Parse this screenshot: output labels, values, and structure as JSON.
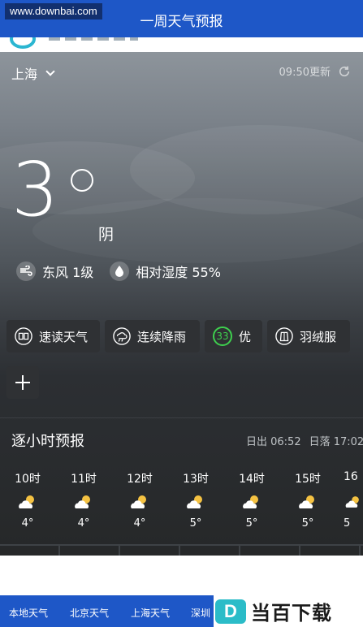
{
  "watermark": "www.downbai.com",
  "header": {
    "title": "一周天气预报"
  },
  "weather": {
    "city": "上海",
    "updated": "09:50更新",
    "temperature": "3",
    "condition": "阴",
    "wind": "东风 1级",
    "humidity": "相对湿度 55%"
  },
  "chips": [
    {
      "label": "速读天气",
      "icon": "book-icon"
    },
    {
      "label": "连续降雨",
      "icon": "rain-cloud-icon"
    },
    {
      "label": "优",
      "aqi": "33",
      "icon": "aqi-ring-icon"
    },
    {
      "label": "羽绒服",
      "icon": "coat-icon"
    }
  ],
  "hourly": {
    "title": "逐小时预报",
    "sunrise": "日出 06:52",
    "sunset": "日落 17:02",
    "items": [
      {
        "time": "10时",
        "temp": "4°"
      },
      {
        "time": "11时",
        "temp": "4°"
      },
      {
        "time": "12时",
        "temp": "4°"
      },
      {
        "time": "13时",
        "temp": "5°"
      },
      {
        "time": "14时",
        "temp": "5°"
      },
      {
        "time": "15时",
        "temp": "5°"
      },
      {
        "time": "16",
        "temp": "5"
      }
    ]
  },
  "bottom_nav": {
    "tabs": [
      "本地天气",
      "北京天气",
      "上海天气",
      "深圳"
    ],
    "brand_letter": "D",
    "brand_text": "当百下载"
  },
  "colors": {
    "accent": "#1e57c7",
    "aqi_good": "#3ecf4e",
    "brand_teal": "#2bbcc8"
  }
}
